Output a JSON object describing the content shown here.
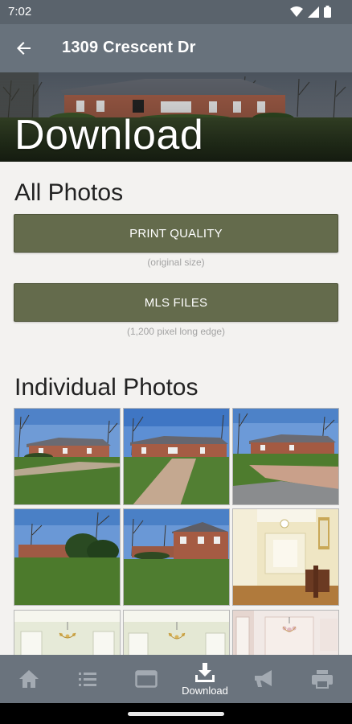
{
  "status_bar": {
    "time": "7:02"
  },
  "app_bar": {
    "title": "1309 Crescent Dr"
  },
  "hero": {
    "title": "Download"
  },
  "all_photos": {
    "heading": "All Photos",
    "print_quality_label": "PRINT QUALITY",
    "print_quality_note": "(original size)",
    "mls_files_label": "MLS FILES",
    "mls_files_note": "(1,200 pixel long edge)"
  },
  "individual_photos": {
    "heading": "Individual Photos",
    "photos": [
      "exterior-front-left",
      "exterior-front",
      "exterior-driveway",
      "exterior-side",
      "exterior-rear",
      "interior-foyer",
      "interior-dining",
      "interior-dining-2",
      "interior-hall"
    ]
  },
  "bottom_nav": {
    "items": [
      {
        "icon": "home-icon",
        "label": ""
      },
      {
        "icon": "list-icon",
        "label": ""
      },
      {
        "icon": "window-icon",
        "label": ""
      },
      {
        "icon": "download-icon",
        "label": "Download"
      },
      {
        "icon": "megaphone-icon",
        "label": ""
      },
      {
        "icon": "printer-icon",
        "label": ""
      }
    ]
  },
  "colors": {
    "status_bar": "#5a636c",
    "app_bar": "#68727c",
    "button": "#646b4c",
    "background": "#f3f2f0",
    "bottom_nav": "#6a737d"
  }
}
